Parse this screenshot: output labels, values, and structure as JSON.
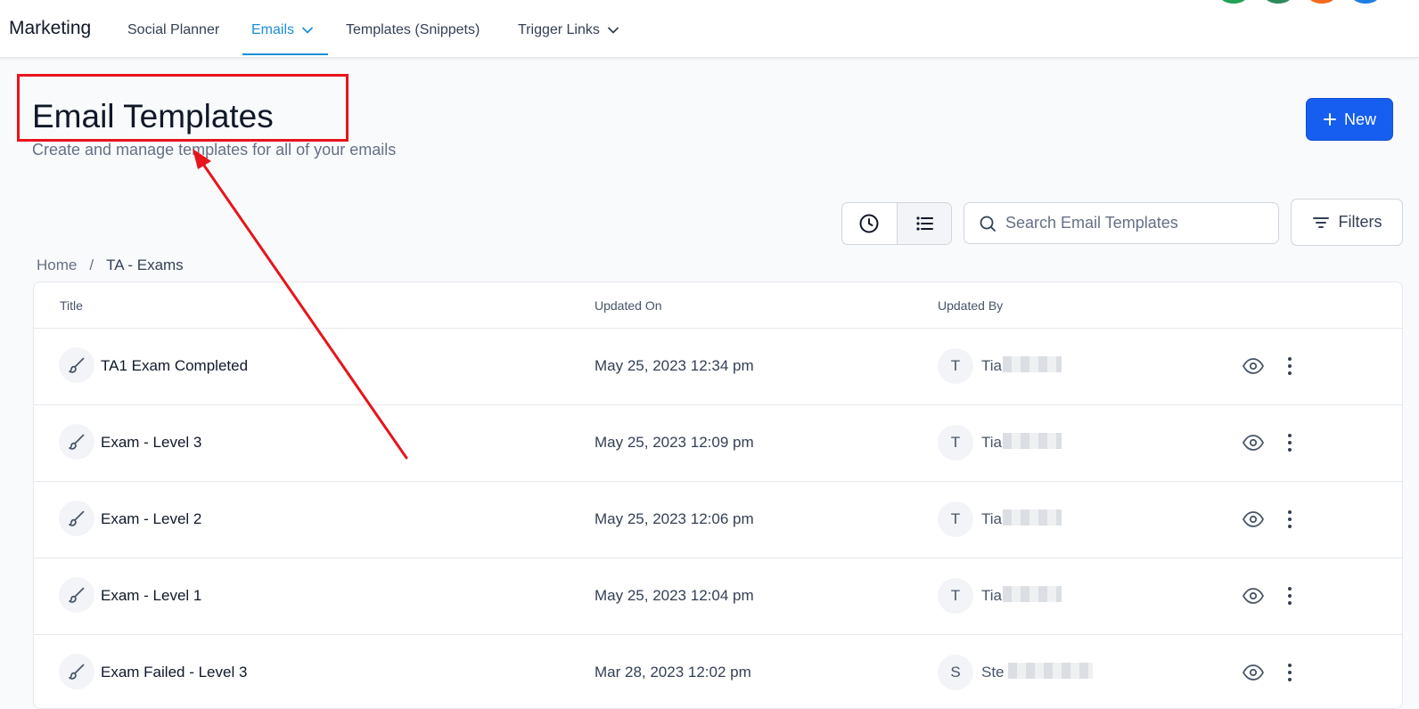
{
  "nav": {
    "brand": "Marketing",
    "items": [
      {
        "label": "Social Planner"
      },
      {
        "label": "Emails"
      },
      {
        "label": "Templates (Snippets)"
      },
      {
        "label": "Trigger Links"
      }
    ]
  },
  "header": {
    "title": "Email Templates",
    "subtitle": "Create and manage templates for all of your emails",
    "new_label": "New"
  },
  "toolbar": {
    "search_placeholder": "Search Email Templates",
    "filters_label": "Filters"
  },
  "breadcrumb": {
    "home": "Home",
    "separator": "/",
    "current": "TA - Exams"
  },
  "table": {
    "columns": [
      "Title",
      "Updated On",
      "Updated By"
    ],
    "rows": [
      {
        "title": "TA1 Exam Completed",
        "updated_on": "May 25, 2023 12:34 pm",
        "initial": "T",
        "user": "Tia"
      },
      {
        "title": "Exam - Level 3",
        "updated_on": "May 25, 2023 12:09 pm",
        "initial": "T",
        "user": "Tia"
      },
      {
        "title": "Exam - Level 2",
        "updated_on": "May 25, 2023 12:06 pm",
        "initial": "T",
        "user": "Tia"
      },
      {
        "title": "Exam - Level 1",
        "updated_on": "May 25, 2023 12:04 pm",
        "initial": "T",
        "user": "Tia"
      },
      {
        "title": "Exam Failed - Level 3",
        "updated_on": "Mar 28, 2023 12:02 pm",
        "initial": "S",
        "user": "Ste"
      }
    ]
  },
  "colors": {
    "accent": "#155eef",
    "nav_active": "#1b8fd6",
    "annotation": "#e8141b"
  },
  "icons": [
    "chevron-down-icon",
    "plus-icon",
    "clock-icon",
    "list-icon",
    "search-icon",
    "filter-icon",
    "brush-icon",
    "eye-icon",
    "more-vertical-icon"
  ]
}
